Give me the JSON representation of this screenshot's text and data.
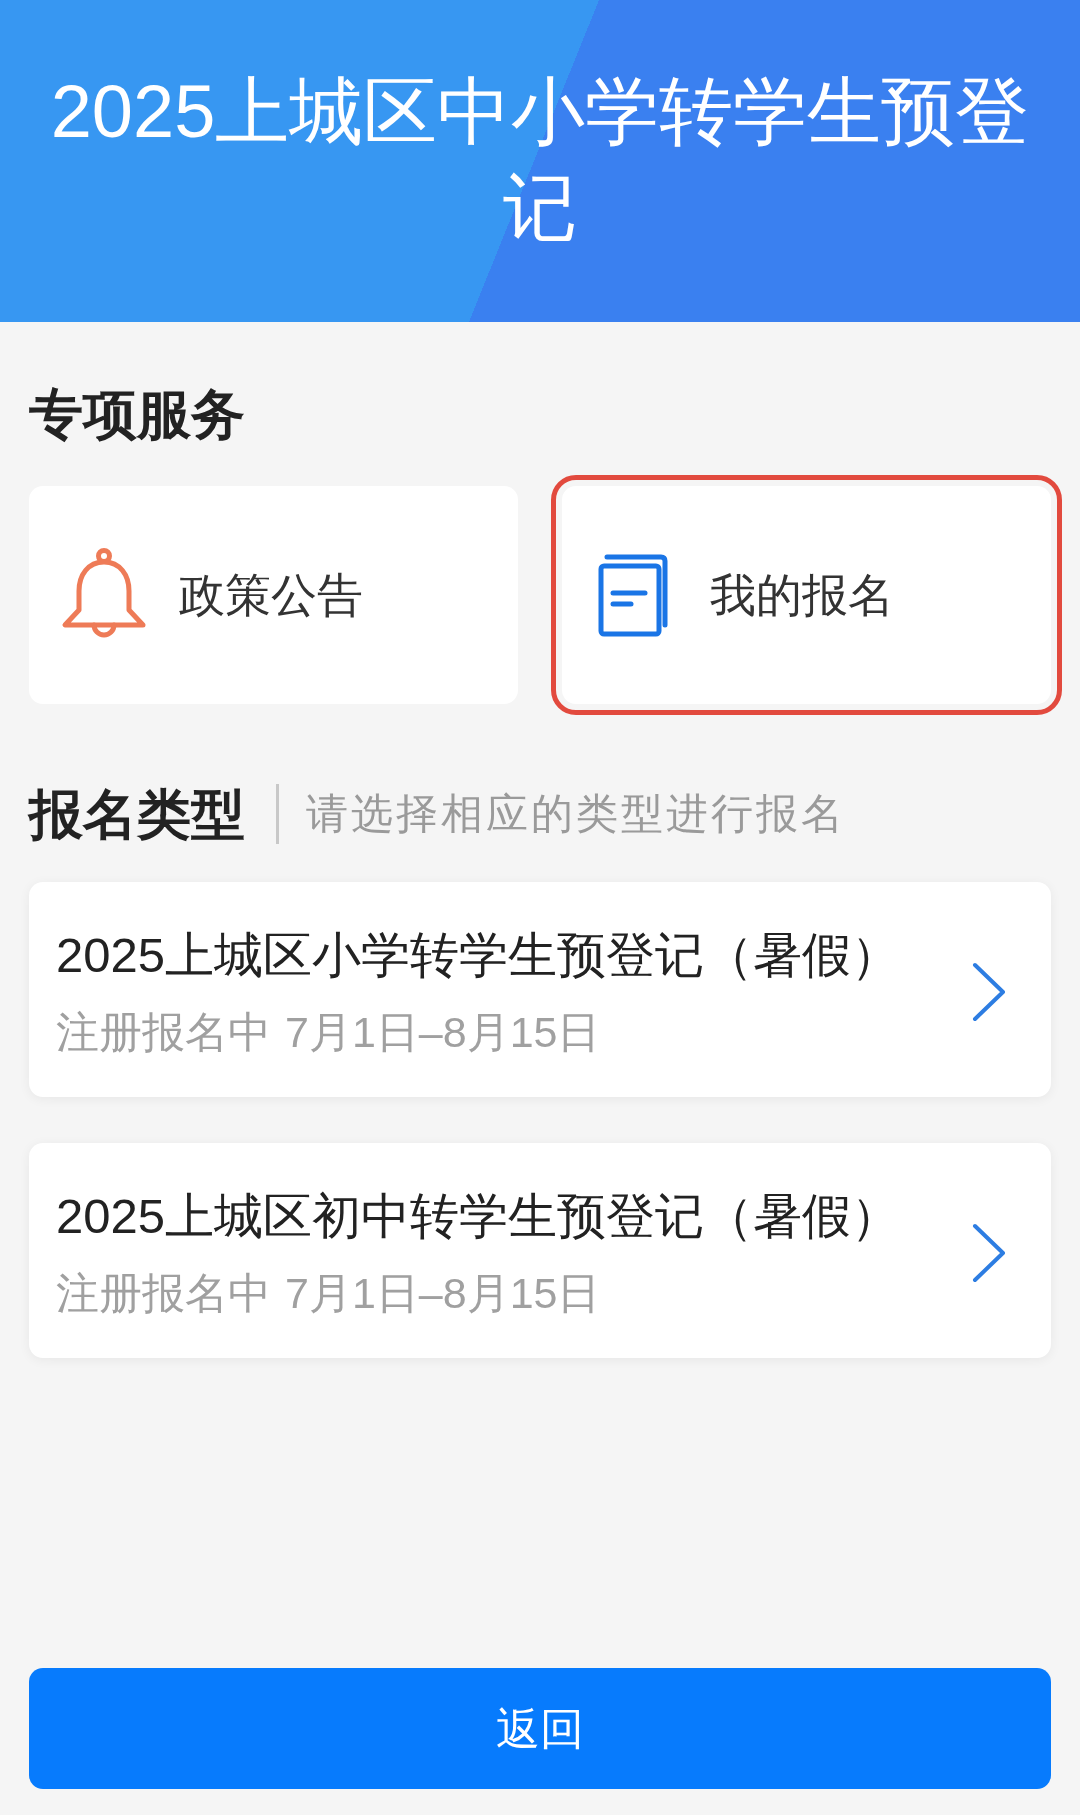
{
  "header": {
    "title": "2025上城区中小学转学生预登记"
  },
  "services": {
    "title": "专项服务",
    "items": [
      {
        "kind": "notice",
        "label": "政策公告",
        "highlighted": false
      },
      {
        "kind": "enrollment",
        "label": "我的报名",
        "highlighted": true
      }
    ]
  },
  "registration_types": {
    "title": "报名类型",
    "hint": "请选择相应的类型进行报名",
    "items": [
      {
        "title": "2025上城区小学转学生预登记（暑假）",
        "status": "注册报名中",
        "period": "7月1日–8月15日"
      },
      {
        "title": "2025上城区初中转学生预登记（暑假）",
        "status": "注册报名中",
        "period": "7月1日–8月15日"
      }
    ]
  },
  "back_button": {
    "label": "返回"
  }
}
